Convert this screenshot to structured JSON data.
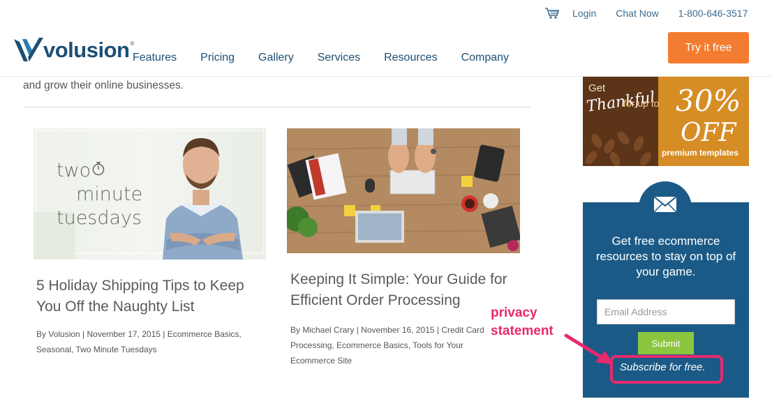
{
  "header": {
    "login": "Login",
    "chat": "Chat Now",
    "phone": "1-800-646-3517",
    "logo_text": "volusion",
    "logo_mark": "®",
    "nav": [
      "Features",
      "Pricing",
      "Gallery",
      "Services",
      "Resources",
      "Company"
    ],
    "cta": "Try it free"
  },
  "main": {
    "intro": "and grow their online businesses.",
    "posts": [
      {
        "thumb_text": [
          "two",
          "minute",
          "tuesdays"
        ],
        "title": "5 Holiday Shipping Tips to Keep You Off the Naughty List",
        "author": "By Volusion",
        "date": "November 17, 2015",
        "categories": "Ecommerce Basics, Seasonal, Two Minute Tuesdays"
      },
      {
        "title": "Keeping It Simple: Your Guide for Efficient Order Processing",
        "author": "By Michael Crary",
        "date": "November 16, 2015",
        "categories": "Credit Card Processing, Ecommerce Basics, Tools for Your Ecommerce Site"
      }
    ]
  },
  "sidebar": {
    "promo": {
      "get": "Get",
      "thankful": "Thankful",
      "for_up_to": "for up to",
      "percent": "30%",
      "off": "OFF",
      "subtitle": "premium templates"
    },
    "newsletter": {
      "heading": "Get free ecommerce resources to stay on top of your game.",
      "email_placeholder": "Email Address",
      "submit": "Submit",
      "subscribe_note": "Subscribe for free."
    }
  },
  "annotation": {
    "line1": "privacy",
    "line2": "statement",
    "color": "#e8296e"
  },
  "colors": {
    "brand_blue": "#1d4f74",
    "cta_orange": "#f47c30",
    "newsletter_bg": "#1b5a86",
    "submit_green": "#8cc63f"
  }
}
